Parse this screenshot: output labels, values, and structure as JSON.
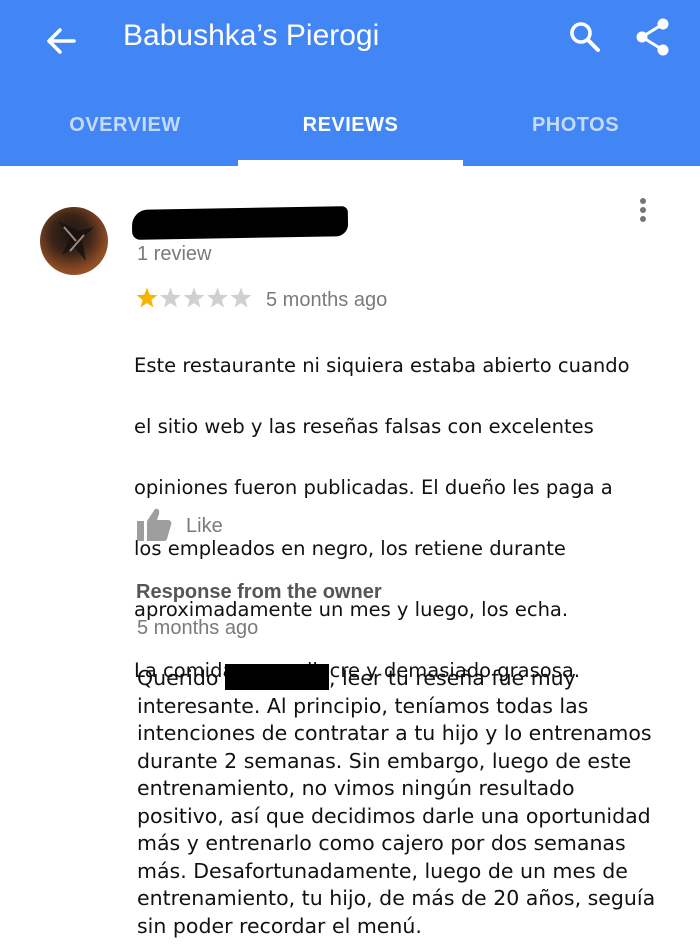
{
  "appbar": {
    "title": "Babushka’s Pierogi",
    "back_icon": "arrow-back-icon",
    "search_icon": "search-icon",
    "share_icon": "share-icon",
    "color": "#4285f4"
  },
  "tabs": [
    {
      "label": "OVERVIEW",
      "active": false
    },
    {
      "label": "REVIEWS",
      "active": true
    },
    {
      "label": "PHOTOS",
      "active": false
    }
  ],
  "review": {
    "reviewer_review_count": "1 review",
    "rating": 1,
    "rating_max": 5,
    "time": "5 months ago",
    "text_lines": [
      "Este restaurante ni siquiera estaba abierto cuando",
      "el sitio web y las reseñas falsas con excelentes",
      "opiniones fueron publicadas. El dueño les paga a",
      "los empleados en negro, los retiene durante",
      "aproximadamente un mes y luego, los echa.",
      "La comida es mediocre y demasiado grasosa."
    ],
    "like_label": "Like",
    "star_color": "#f4b400"
  },
  "owner_response": {
    "title": "Response from the owner",
    "time": "5 months ago",
    "text_before": "Querido",
    "text_after": ", leer tu reseña fue muy interesante. Al principio, teníamos todas las intenciones de contratar a tu hijo y lo entrenamos durante 2 semanas. Sin embargo, luego de este entrenamiento, no vimos ningún resultado positivo, así que decidimos darle una oportunidad más y entrenarlo como cajero por dos semanas más. Desafortunadamente, luego de un mes de entrenamiento, tu hijo, de más de 20 años, seguía sin poder recordar el menú."
  }
}
